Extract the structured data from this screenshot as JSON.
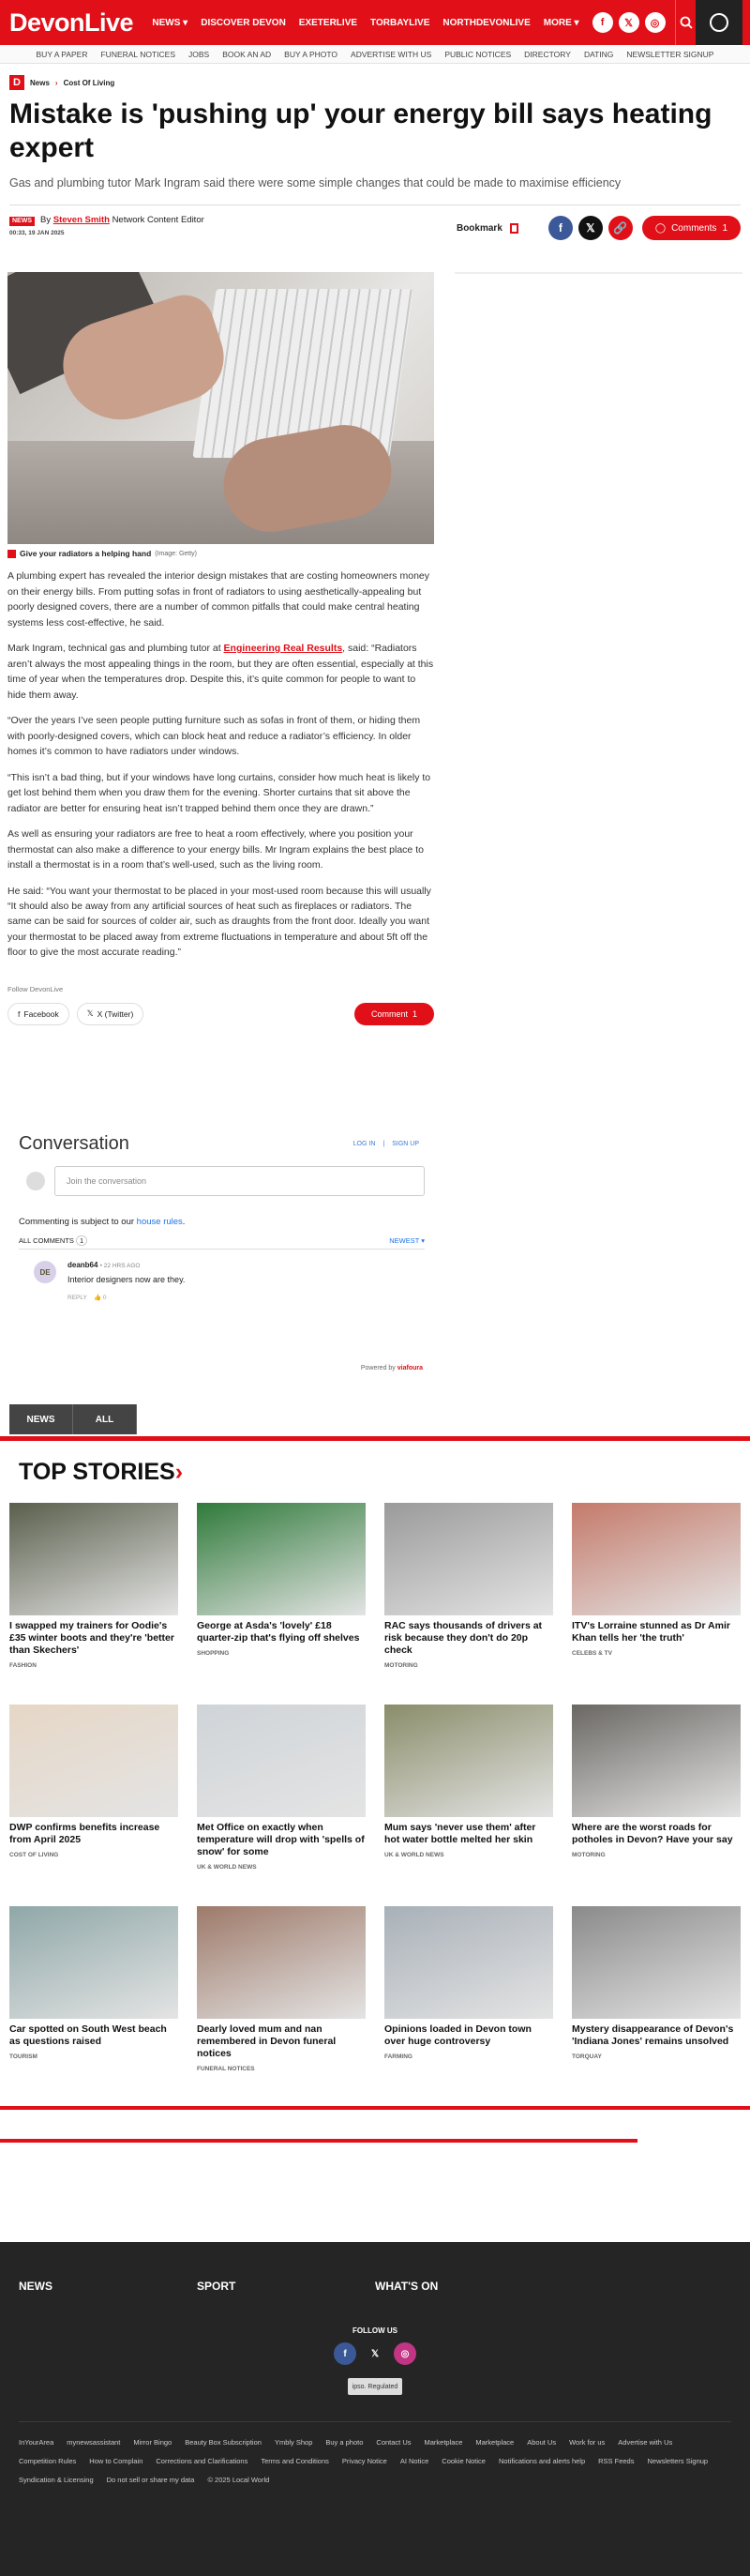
{
  "header": {
    "logo": "DevonLive",
    "nav": [
      "NEWS ▾",
      "DISCOVER DEVON",
      "EXETERLIVE",
      "TORBAYLIVE",
      "NORTHDEVONLIVE",
      "MORE ▾"
    ],
    "social_icons": [
      "facebook-icon",
      "x-icon",
      "instagram-icon"
    ],
    "subnav": [
      "BUY A PAPER",
      "FUNERAL NOTICES",
      "JOBS",
      "BOOK AN AD",
      "BUY A PHOTO",
      "ADVERTISE WITH US",
      "PUBLIC NOTICES",
      "DIRECTORY",
      "DATING",
      "NEWSLETTER SIGNUP"
    ]
  },
  "breadcrumb": {
    "badge": "D",
    "items": [
      "News",
      "Cost Of Living"
    ],
    "sep": "›"
  },
  "article": {
    "title": "Mistake is 'pushing up' your energy bill says heating expert",
    "standfirst": "Gas and plumbing tutor Mark Ingram said there were some simple changes that could be made to maximise efficiency",
    "badge": "NEWS",
    "by": "By",
    "author": "Steven Smith",
    "role": "Network Content Editor",
    "date": "00:33, 19 JAN 2025",
    "bookmark": "Bookmark",
    "comments_label": "Comments",
    "comments_count": "1",
    "caption": "Give your radiators a helping hand",
    "caption_credit": "(Image: Getty)",
    "p1": "A plumbing expert has revealed the interior design mistakes that are costing homeowners money on their energy bills. From putting sofas in front of radiators to using aesthetically-appealing but poorly designed covers, there are a number of common pitfalls that could make central heating systems less cost-effective, he said.",
    "p2_before": "Mark Ingram, technical gas and plumbing tutor at ",
    "p2_link": "Engineering Real Results",
    "p2_after": ", said: “Radiators aren’t always the most appealing things in the room, but they are often essential, especially at this time of year when the temperatures drop. Despite this, it’s quite common for people to want to hide them away.",
    "p3": "“Over the years I’ve seen people putting furniture such as sofas in front of them, or hiding them with poorly-designed covers, which can block heat and reduce a radiator’s efficiency. In older homes it’s common to have radiators under windows.",
    "p4": "“This isn’t a bad thing, but if your windows have long curtains, consider how much heat is likely to get lost behind them when you draw them for the evening. Shorter curtains that sit above the radiator are better for ensuring heat isn’t trapped behind them once they are drawn.”",
    "p5": "As well as ensuring your radiators are free to heat a room effectively, where you position your thermostat can also make a difference to your energy bills. Mr Ingram explains the best place to install a thermostat is in a room that’s well-used, such as the living room.",
    "p6": "He said: “You want your thermostat to be placed in your most-used room because this will usually be your warmest. If you place it in a cold spare room or a hallway this will mean it",
    "p7": "“It should also be away from any artificial sources of heat such as fireplaces or radiators. The same can be said for sources of colder air, such as draughts from the front door. Ideally you want your thermostat to be placed away from extreme fluctuations in temperature and about 5ft off the floor to give the most accurate reading.”",
    "follow": "Follow DevonLive",
    "share_facebook": "Facebook",
    "share_x": "X (Twitter)",
    "comment_btn": "Comment",
    "comment_btn_count": "1"
  },
  "conversation": {
    "title": "Conversation",
    "login": "LOG IN",
    "signup": "SIGN UP",
    "placeholder": "Join the conversation",
    "rules_prefix": "Commenting is subject to our ",
    "rules_link": "house rules",
    "rules_suffix": ".",
    "all_comments": "ALL COMMENTS",
    "count": "1",
    "sort": "NEWEST ▾",
    "comment": {
      "initials": "DE",
      "user": "deanb64",
      "time": "• 22 HRS AGO",
      "text": "Interior designers now are they.",
      "reply": "REPLY",
      "likes": "0"
    },
    "powered": "Powered by",
    "powered_brand": "viafoura"
  },
  "news_tabs": [
    "NEWS",
    "ALL"
  ],
  "top_stories": {
    "title": "TOP STORIES",
    "arrow": "›"
  },
  "stories": [
    {
      "title": "I swapped my trainers for Oodie's £35 winter boots and they're 'better than Skechers'",
      "cat": "FASHION",
      "img": "#5a5f4c"
    },
    {
      "title": "George at Asda's 'lovely' £18 quarter-zip that's flying off shelves",
      "cat": "SHOPPING",
      "img": "#2f7a3a"
    },
    {
      "title": "RAC says thousands of drivers at risk because they don't do 20p check",
      "cat": "MOTORING",
      "img": "#9a9a9a"
    },
    {
      "title": "ITV's Lorraine stunned as Dr Amir Khan tells her 'the truth'",
      "cat": "CELEBS & TV",
      "img": "#c47a6a"
    },
    {
      "title": "DWP confirms benefits increase from April 2025",
      "cat": "COST OF LIVING",
      "img": "#e6d7c6"
    },
    {
      "title": "Met Office on exactly when temperature will drop with 'spells of snow' for some",
      "cat": "UK & WORLD NEWS",
      "img": "#cfd4d8"
    },
    {
      "title": "Mum says 'never use them' after hot water bottle melted her skin",
      "cat": "UK & WORLD NEWS",
      "img": "#8a8d6a"
    },
    {
      "title": "Where are the worst roads for potholes in Devon? Have your say",
      "cat": "MOTORING",
      "img": "#6a6763"
    },
    {
      "title": "Car spotted on South West beach as questions raised",
      "cat": "TOURISM",
      "img": "#8fa7a8"
    },
    {
      "title": "Dearly loved mum and nan remembered in Devon funeral notices",
      "cat": "FUNERAL NOTICES",
      "img": "#9e7a6a"
    },
    {
      "title": "Opinions loaded in Devon town over huge controversy",
      "cat": "FARMING",
      "img": "#a8b0b8"
    },
    {
      "title": "Mystery disappearance of Devon's 'Indiana Jones' remains unsolved",
      "cat": "TORQUAY",
      "img": "#8a8a8a"
    }
  ],
  "footer": {
    "cols": [
      "NEWS",
      "SPORT",
      "WHAT'S ON"
    ],
    "follow": "FOLLOW US",
    "ipso": "ipso. Regulated",
    "links": [
      "InYourArea",
      "mynewsassistant",
      "Mirror Bingo",
      "Beauty Box Subscription",
      "Ymbly Shop",
      "Buy a photo",
      "Contact Us",
      "Marketplace",
      "Marketplace",
      "About Us",
      "Work for us",
      "Advertise with Us",
      "Competition Rules",
      "How to Complain",
      "Corrections and Clarifications",
      "Terms and Conditions",
      "Privacy Notice",
      "AI Notice",
      "Cookie Notice",
      "Notifications and alerts help",
      "RSS Feeds",
      "Newsletters Signup",
      "Syndication & Licensing",
      "Do not sell or share my data",
      "© 2025 Local World"
    ]
  },
  "colors": {
    "brand": "#e10f18",
    "facebook": "#3b5998",
    "x": "#111111",
    "link": "#1b73e8"
  }
}
